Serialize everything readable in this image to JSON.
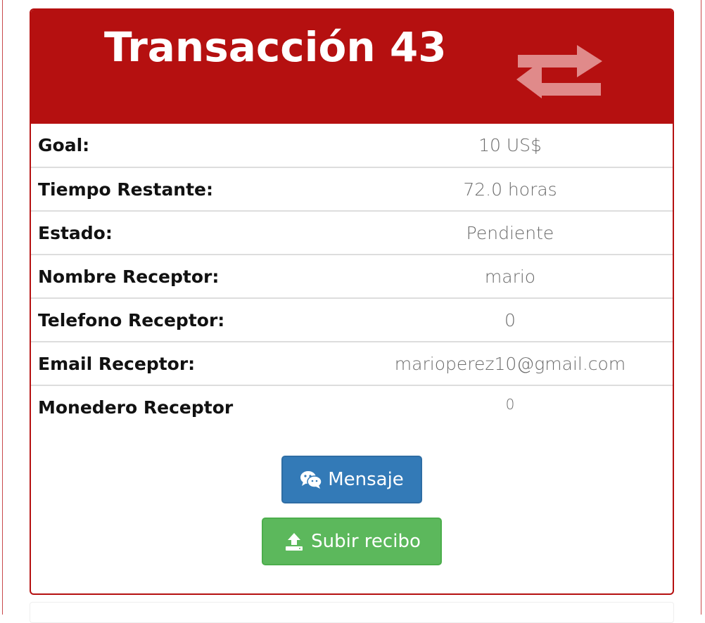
{
  "transaction": {
    "title": "Transacción 43",
    "header_icon": "exchange-arrows-icon",
    "header_color": "#b51010"
  },
  "details": [
    {
      "label": "Goal:",
      "value": "10 US$"
    },
    {
      "label": "Tiempo Restante:",
      "value": "72.0 horas"
    },
    {
      "label": "Estado:",
      "value": "Pendiente"
    },
    {
      "label": "Nombre Receptor:",
      "value": "mario"
    },
    {
      "label": "Telefono Receptor:",
      "value": "0"
    },
    {
      "label": "Email Receptor:",
      "value": "marioperez10@gmail.com"
    },
    {
      "label": "Monedero Receptor",
      "value": "0"
    }
  ],
  "actions": {
    "message": {
      "label": "Mensaje",
      "icon": "wechat-icon",
      "color": "#337ab7"
    },
    "upload": {
      "label": "Subir recibo",
      "icon": "upload-icon",
      "color": "#5cb85c"
    }
  }
}
